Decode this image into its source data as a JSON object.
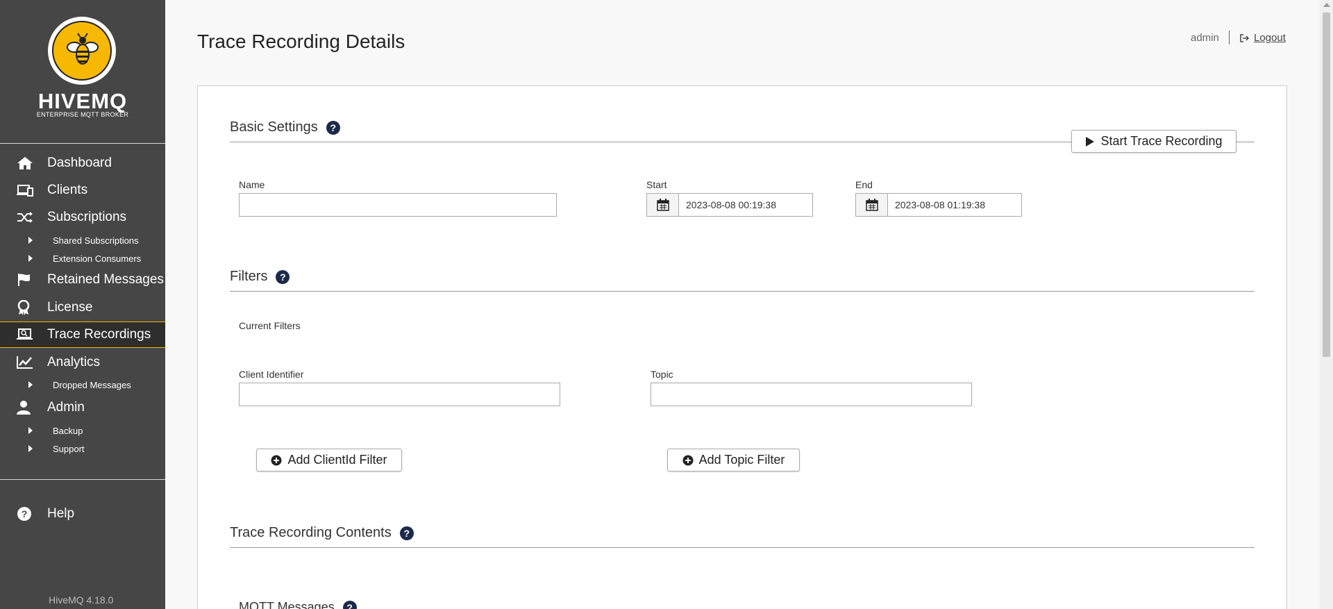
{
  "brand": {
    "name": "HIVEMQ",
    "tagline": "ENTERPRISE MQTT BROKER",
    "accent": "#f6b800"
  },
  "sidebar": {
    "items": [
      {
        "label": "Dashboard",
        "icon": "home-icon"
      },
      {
        "label": "Clients",
        "icon": "devices-icon"
      },
      {
        "label": "Subscriptions",
        "icon": "shuffle-icon"
      },
      {
        "label": "Retained Messages",
        "icon": "flag-icon"
      },
      {
        "label": "License",
        "icon": "award-icon"
      },
      {
        "label": "Trace Recordings",
        "icon": "laptop-search-icon"
      },
      {
        "label": "Analytics",
        "icon": "chart-line-icon"
      },
      {
        "label": "Admin",
        "icon": "user-icon"
      }
    ],
    "subitems": {
      "subscriptions": [
        "Shared Subscriptions",
        "Extension Consumers"
      ],
      "analytics": [
        "Dropped Messages"
      ],
      "admin": [
        "Backup",
        "Support"
      ]
    },
    "help": "Help",
    "version": "HiveMQ 4.18.0"
  },
  "header": {
    "title": "Trace Recording Details",
    "user": "admin",
    "logout": "Logout"
  },
  "basic_settings": {
    "title": "Basic Settings",
    "start_button": "Start Trace Recording",
    "name_label": "Name",
    "name_value": "",
    "start_label": "Start",
    "start_value": "2023-08-08 00:19:38",
    "end_label": "End",
    "end_value": "2023-08-08 01:19:38"
  },
  "filters": {
    "title": "Filters",
    "current_filters_label": "Current Filters",
    "client_id_label": "Client Identifier",
    "client_id_value": "",
    "topic_label": "Topic",
    "topic_value": "",
    "add_client_button": "Add ClientId Filter",
    "add_topic_button": "Add Topic Filter"
  },
  "contents": {
    "title": "Trace Recording Contents",
    "mqtt_messages": "MQTT Messages"
  }
}
